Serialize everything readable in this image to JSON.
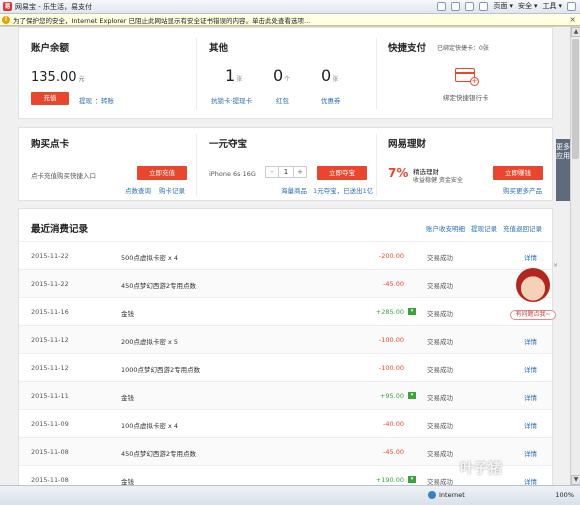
{
  "browser": {
    "tab_title": "网易宝 - 乐生活，易支付",
    "tools": [
      "页面",
      "安全",
      "工具"
    ],
    "infobar_text": "为了保护您的安全，Internet Explorer 已阻止此网站显示有安全证书错误的内容。单击此处查看选项...",
    "status_zone": "Internet",
    "zoom": "100%"
  },
  "balance": {
    "title": "账户余额",
    "amount": "135.00",
    "unit": "元",
    "recharge": "充值",
    "withdraw": "提现",
    "transfer": "转账"
  },
  "others": {
    "title": "其他",
    "items": [
      {
        "num": "1",
        "unit": "张",
        "label": "抗锁卡·提现卡"
      },
      {
        "num": "0",
        "unit": "个",
        "label": "红包"
      },
      {
        "num": "0",
        "unit": "张",
        "label": "优惠券"
      }
    ]
  },
  "quickpay": {
    "title": "快捷支付",
    "bound": "已绑定快捷卡：0张",
    "bind_label": "绑定快捷银行卡"
  },
  "pointcard": {
    "title": "购买点卡",
    "desc": "点卡充值购买快捷入口",
    "btn": "立即充值",
    "link1": "点数查询",
    "link2": "购卡记录"
  },
  "treasure": {
    "title": "一元夺宝",
    "product": "iPhone 6s 16G",
    "qty": "1",
    "btn": "立即夺宝",
    "link": "海量商品",
    "hint": "1元夺宝，已送出1亿"
  },
  "finance": {
    "title": "网易理财",
    "rate": "7%",
    "product": "精选理财",
    "sub": "收益稳健 资金安全",
    "btn": "立即赚钱",
    "more": "购买更多产品"
  },
  "side_tab": "更多应用",
  "records": {
    "title": "最近消费记录",
    "links": [
      "账户收支明细",
      "提现记录",
      "充值退回记录"
    ],
    "rows": [
      {
        "date": "2015-11-22",
        "desc": "500点虚拟卡密 x 4",
        "amount": "-200.00",
        "sign": "neg",
        "status": "交易成功",
        "detail": "详情"
      },
      {
        "date": "2015-11-22",
        "desc": "450点梦幻西游2专用点数",
        "amount": "-45.00",
        "sign": "neg",
        "status": "交易成功",
        "detail": "详情"
      },
      {
        "date": "2015-11-16",
        "desc": "金钱",
        "amount": "+285.00",
        "sign": "pos",
        "status": "交易成功",
        "detail": "详情"
      },
      {
        "date": "2015-11-12",
        "desc": "200点虚拟卡密 x 5",
        "amount": "-100.00",
        "sign": "neg",
        "status": "交易成功",
        "detail": "详情"
      },
      {
        "date": "2015-11-12",
        "desc": "1000点梦幻西游2专用点数",
        "amount": "-100.00",
        "sign": "neg",
        "status": "交易成功",
        "detail": "详情"
      },
      {
        "date": "2015-11-11",
        "desc": "金钱",
        "amount": "+95.00",
        "sign": "pos",
        "status": "交易成功",
        "detail": "详情"
      },
      {
        "date": "2015-11-09",
        "desc": "100点虚拟卡密 x 4",
        "amount": "-40.00",
        "sign": "neg",
        "status": "交易成功",
        "detail": "详情"
      },
      {
        "date": "2015-11-08",
        "desc": "450点梦幻西游2专用点数",
        "amount": "-45.00",
        "sign": "neg",
        "status": "交易成功",
        "detail": "详情"
      },
      {
        "date": "2015-11-08",
        "desc": "金钱",
        "amount": "+190.00",
        "sign": "pos",
        "status": "交易成功",
        "detail": "详情"
      }
    ]
  },
  "assistant": {
    "close": "×",
    "label": "有问题点我~"
  },
  "watermark": {
    "main": "叶子猪",
    "sub": "yzz.cn"
  },
  "colors": {
    "accent": "#e8472d",
    "link": "#2b6fb6",
    "positive": "#3aa43a"
  }
}
